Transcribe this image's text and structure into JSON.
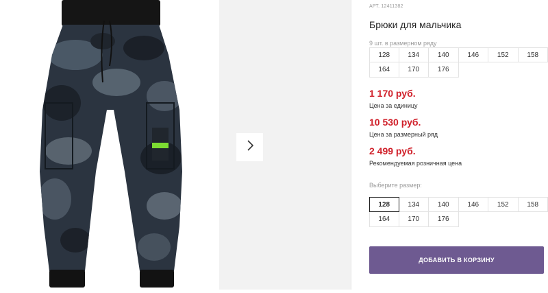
{
  "product": {
    "article": "АРТ. 12411382",
    "title": "Брюки для мальчика",
    "pack_note": "9 шт. в размерном ряду"
  },
  "size_range": [
    "128",
    "134",
    "140",
    "146",
    "152",
    "158",
    "164",
    "170",
    "176"
  ],
  "prices": [
    {
      "value": "1 170 руб.",
      "label": "Цена за единицу"
    },
    {
      "value": "10 530 руб.",
      "label": "Цена за размерный ряд"
    },
    {
      "value": "2 499 руб.",
      "label": "Рекомендуемая розничная цена"
    }
  ],
  "size_picker": {
    "label": "Выберите размер:",
    "selected": "128",
    "sizes": [
      "128",
      "134",
      "140",
      "146",
      "152",
      "158",
      "164",
      "170",
      "176"
    ]
  },
  "cart_button": "ДОБАВИТЬ В КОРЗИНУ",
  "icons": {
    "next": "chevron-right-icon"
  },
  "colors": {
    "price": "#d0202a",
    "accent": "#6e5a91"
  }
}
